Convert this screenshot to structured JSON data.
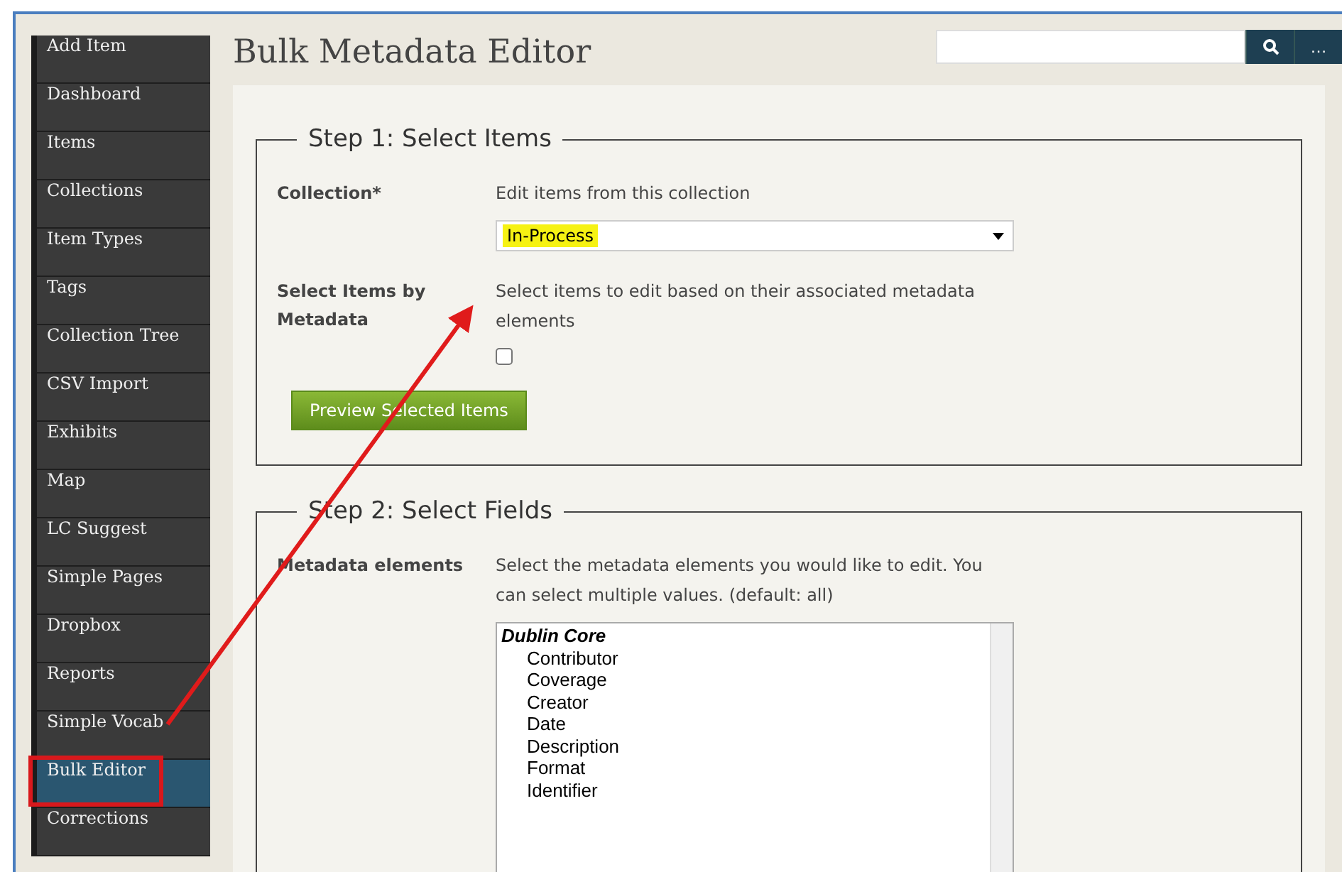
{
  "sidebar": {
    "items": [
      {
        "label": "Add Item",
        "selected": false,
        "callout": false
      },
      {
        "label": "Dashboard",
        "selected": false,
        "callout": false
      },
      {
        "label": "Items",
        "selected": false,
        "callout": false
      },
      {
        "label": "Collections",
        "selected": false,
        "callout": false
      },
      {
        "label": "Item Types",
        "selected": false,
        "callout": false
      },
      {
        "label": "Tags",
        "selected": false,
        "callout": false
      },
      {
        "label": "Collection Tree",
        "selected": false,
        "callout": false
      },
      {
        "label": "CSV Import",
        "selected": false,
        "callout": false
      },
      {
        "label": "Exhibits",
        "selected": false,
        "callout": false
      },
      {
        "label": "Map",
        "selected": false,
        "callout": false
      },
      {
        "label": "LC Suggest",
        "selected": false,
        "callout": false
      },
      {
        "label": "Simple Pages",
        "selected": false,
        "callout": false
      },
      {
        "label": "Dropbox",
        "selected": false,
        "callout": false
      },
      {
        "label": "Reports",
        "selected": false,
        "callout": false
      },
      {
        "label": "Simple Vocab",
        "selected": false,
        "callout": false
      },
      {
        "label": "Bulk Editor",
        "selected": true,
        "callout": true
      },
      {
        "label": "Corrections",
        "selected": false,
        "callout": false
      }
    ]
  },
  "header": {
    "title": "Bulk Metadata Editor",
    "search_button": "…"
  },
  "step1": {
    "legend": "Step 1: Select Items",
    "collection": {
      "label": "Collection*",
      "hint": "Edit items from this collection",
      "value": "In-Process",
      "highlighted": true
    },
    "by_metadata": {
      "label": "Select Items by Metadata",
      "hint": "Select items to edit based on their associated metadata elements",
      "checked": false
    },
    "button": "Preview Selected Items"
  },
  "step2": {
    "legend": "Step 2: Select Fields",
    "label": "Metadata elements",
    "hint": "Select the metadata elements you would like to edit. You can select multiple values. (default: all)",
    "groups": [
      {
        "label": "Dublin Core",
        "children": [
          "Contributor",
          "Coverage",
          "Creator",
          "Date",
          "Description",
          "Format",
          "Identifier"
        ]
      }
    ]
  }
}
